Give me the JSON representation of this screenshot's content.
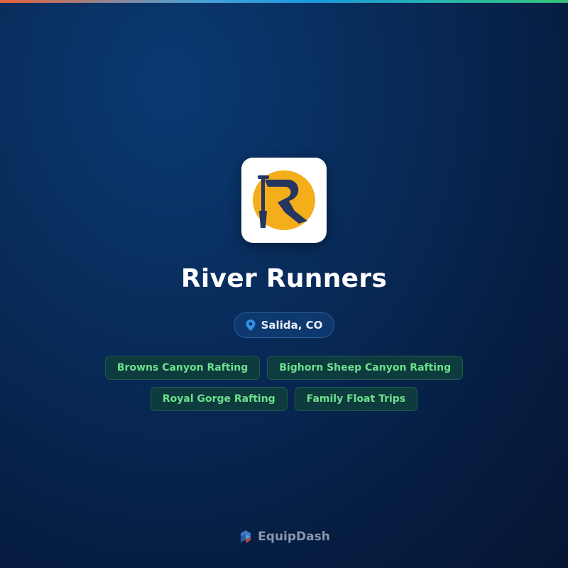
{
  "company": {
    "name": "River Runners",
    "location": "Salida, CO",
    "logo_icon": "river-runners-logo-icon"
  },
  "tags": [
    "Browns Canyon Rafting",
    "Bighorn Sheep Canyon Rafting",
    "Royal Gorge Rafting",
    "Family Float Trips"
  ],
  "footer": {
    "brand": "EquipDash",
    "brand_icon": "equipdash-logo-icon"
  },
  "colors": {
    "background": "#082a58",
    "tag_text": "#6ee08e",
    "pin": "#2f8fe6",
    "logo_circle": "#f4ae1c",
    "logo_mark": "#26365f"
  }
}
